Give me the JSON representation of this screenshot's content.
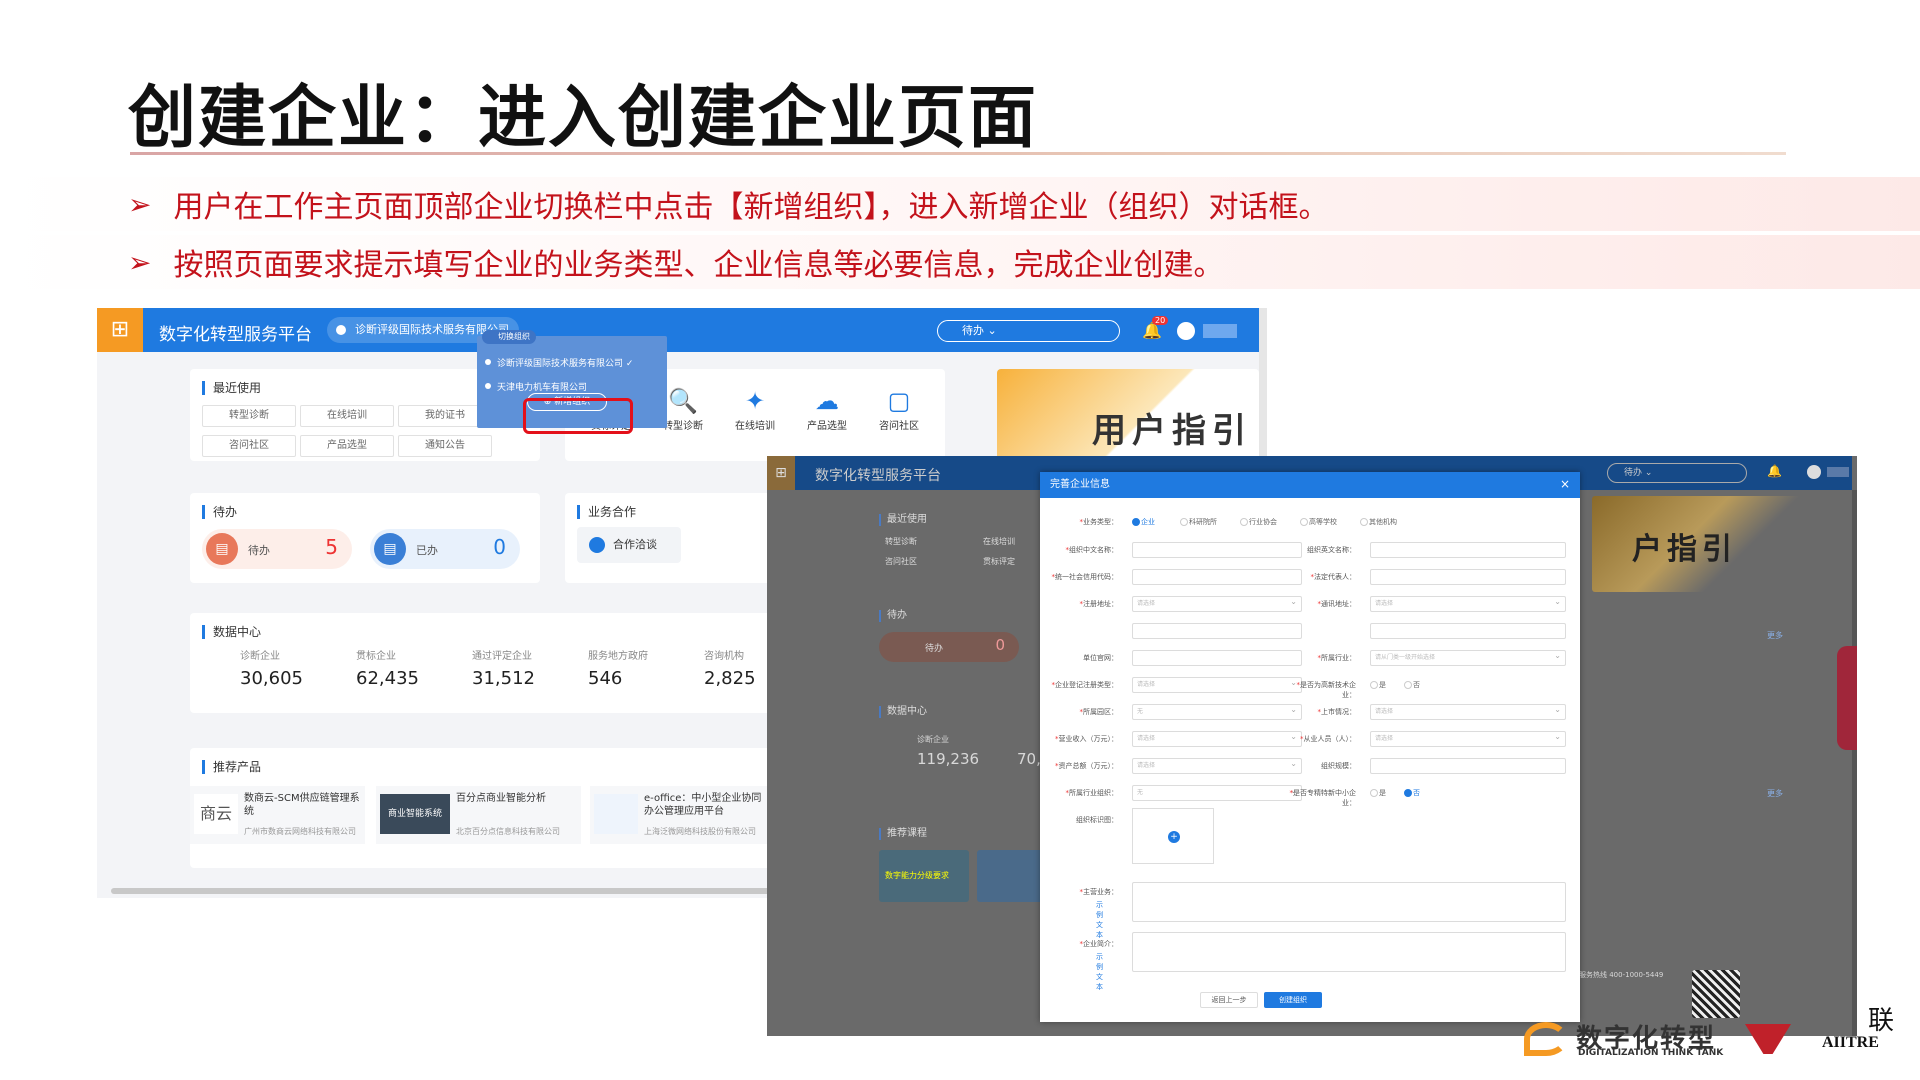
{
  "slide": {
    "title": "创建企业：进入创建企业页面",
    "bullets": [
      "用户在工作主页面顶部企业切换栏中点击【新增组织】，进入新增企业（组织）对话框。",
      "按照页面要求提示填写企业的业务类型、企业信息等必要信息，完成企业创建。"
    ],
    "bullet_marker": "➢"
  },
  "main_window": {
    "platform_name": "数字化转型服务平台",
    "current_org": "诊断评级国际技术服务有限公司",
    "search_placeholder": "待办 ⌄",
    "notification_count": "20",
    "accent_color": "#1f7ae0",
    "logo_color": "#f59a23",
    "recent": {
      "title": "最近使用",
      "items": [
        "转型诊断",
        "在线培训",
        "我的证书",
        "咨问社区",
        "产品选型",
        "通知公告"
      ]
    },
    "tools": [
      {
        "label": "贯标评定",
        "icon": "badge-icon"
      },
      {
        "label": "转型诊断",
        "icon": "magnifier-icon"
      },
      {
        "label": "在线培训",
        "icon": "runner-icon"
      },
      {
        "label": "产品选型",
        "icon": "cloud-icon"
      },
      {
        "label": "咨问社区",
        "icon": "board-icon"
      }
    ],
    "guide_banner": "用户指引",
    "todo": {
      "title": "待办",
      "pending_label": "待办",
      "pending_count": "5",
      "done_label": "已办",
      "done_count": "0"
    },
    "cooperation": {
      "title": "业务合作",
      "button": "合作洽谈"
    },
    "data_center": {
      "title": "数据中心",
      "stats": [
        {
          "label": "诊断企业",
          "value": "30,605"
        },
        {
          "label": "贯标企业",
          "value": "62,435"
        },
        {
          "label": "通过评定企业",
          "value": "31,512"
        },
        {
          "label": "服务地方政府",
          "value": "546"
        },
        {
          "label": "咨询机构",
          "value": "2,825"
        }
      ]
    },
    "products": {
      "title": "推荐产品",
      "items": [
        {
          "name": "数商云-SCM供应链管理系统",
          "vendor": "广州市数商云网络科技有限公司",
          "logo": "商云"
        },
        {
          "name": "百分点商业智能分析",
          "vendor": "北京百分点信息科技有限公司",
          "logo": "商业智能系统"
        },
        {
          "name": "e-office：中小型企业协同办公管理应用平台",
          "vendor": "上海泛微网络科技股份有限公司",
          "logo": ""
        }
      ]
    },
    "org_switcher": {
      "header": "切换组织",
      "orgs": [
        "诊断评级国际技术服务有限公司 ✓",
        "天津电力机车有限公司"
      ],
      "add_label": "⊕ 新增组织"
    }
  },
  "dialog_window": {
    "platform_name": "数字化转型服务平台",
    "search_placeholder": "待办 ⌄",
    "guide_banner": "户指引",
    "recent_title": "最近使用",
    "recent_items": [
      "转型诊断",
      "在线培训",
      "咨问社区",
      "贯标评定"
    ],
    "todo_title": "待办",
    "todo_label": "待办",
    "todo_count": "0",
    "data_title": "数据中心",
    "data_label": "诊断企业",
    "data_value": "119,236",
    "data_value_partial": "70,",
    "course_title": "推荐课程",
    "course_text": "数字能力分级要求",
    "more": "更多",
    "contact": "服务热线 400-1000-5449",
    "modal": {
      "title": "完善企业信息",
      "close": "×",
      "biz_type_label": "业务类型：",
      "biz_types": [
        "企业",
        "科研院所",
        "行业协会",
        "高等学校",
        "其他机构"
      ],
      "fields_left": [
        {
          "label": "组织中文名称：",
          "value": ""
        },
        {
          "label": "统一社会信用代码：",
          "value": ""
        },
        {
          "label": "注册地址：",
          "value": "请选择"
        },
        {
          "label": "",
          "value": ""
        },
        {
          "label": "单位官网：",
          "value": ""
        },
        {
          "label": "企业登记注册类型：",
          "value": "请选择"
        },
        {
          "label": "所属园区：",
          "value": "无"
        },
        {
          "label": "营业收入（万元）：",
          "value": "请选择"
        },
        {
          "label": "资产总额（万元）：",
          "value": "请选择"
        },
        {
          "label": "所属行业组织：",
          "value": "无"
        }
      ],
      "fields_right": [
        {
          "label": "组织英文名称：",
          "value": ""
        },
        {
          "label": "法定代表人：",
          "value": ""
        },
        {
          "label": "通讯地址：",
          "value": "请选择"
        },
        {
          "label": "",
          "value": ""
        },
        {
          "label": "所属行业：",
          "value": "请从门类一级开始选择"
        },
        {
          "label": "是否为高新技术企业：",
          "value": ""
        },
        {
          "label": "上市情况：",
          "value": "请选择"
        },
        {
          "label": "从业人员（人）：",
          "value": "请选择"
        },
        {
          "label": "组织规模：",
          "value": ""
        },
        {
          "label": "是否专精特新中小企业：",
          "value": ""
        }
      ],
      "yes": "是",
      "no": "否",
      "logo_label": "组织标识图：",
      "logo_add": "+",
      "main_business_label": "主营业务：",
      "intro_label": "企业简介：",
      "sample_link": "示例文本",
      "sample_link2": "示例文本",
      "prev_button": "返回上一步",
      "create_button": "创建组织"
    }
  },
  "footer": {
    "brand1_name": "数字化转型",
    "brand1_sub": "DIGITALIZATION THINK TANK",
    "brand2_cn": "联",
    "brand2_en": "AIITRE"
  }
}
